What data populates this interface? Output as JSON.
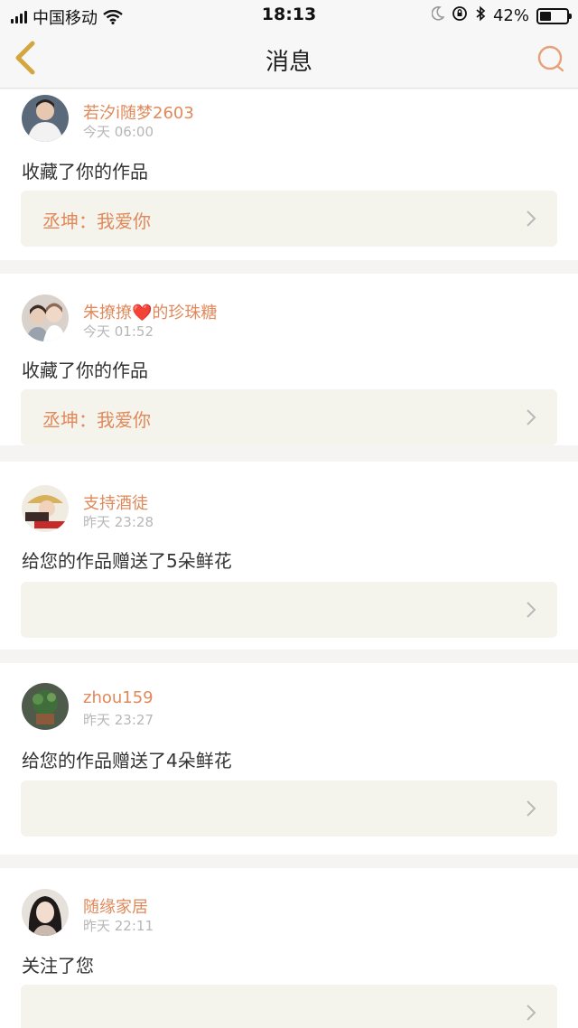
{
  "status_bar": {
    "carrier": "中国移动",
    "time": "18:13",
    "battery": "42%",
    "battery_level": 0.42
  },
  "nav": {
    "title": "消息",
    "back_icon": "chevron-left-icon",
    "search_icon": "search-icon"
  },
  "accent_color": "#e0895a",
  "messages": [
    {
      "user": "若汐i随梦2603",
      "time": "今天 06:00",
      "action": "收藏了你的作品",
      "work": "丞坤：我爱你"
    },
    {
      "user": "朱撩撩❤️的珍珠糖",
      "time": "今天 01:52",
      "action": "收藏了你的作品",
      "work": "丞坤：我爱你"
    },
    {
      "user": "支持酒徒",
      "time": "昨天 23:28",
      "action": "给您的作品赠送了5朵鲜花",
      "work": ""
    },
    {
      "user": "zhou159",
      "time": "昨天 23:27",
      "action": "给您的作品赠送了4朵鲜花",
      "work": ""
    },
    {
      "user": "随缘家居",
      "time": "昨天 22:11",
      "action": "关注了您",
      "work": ""
    }
  ]
}
